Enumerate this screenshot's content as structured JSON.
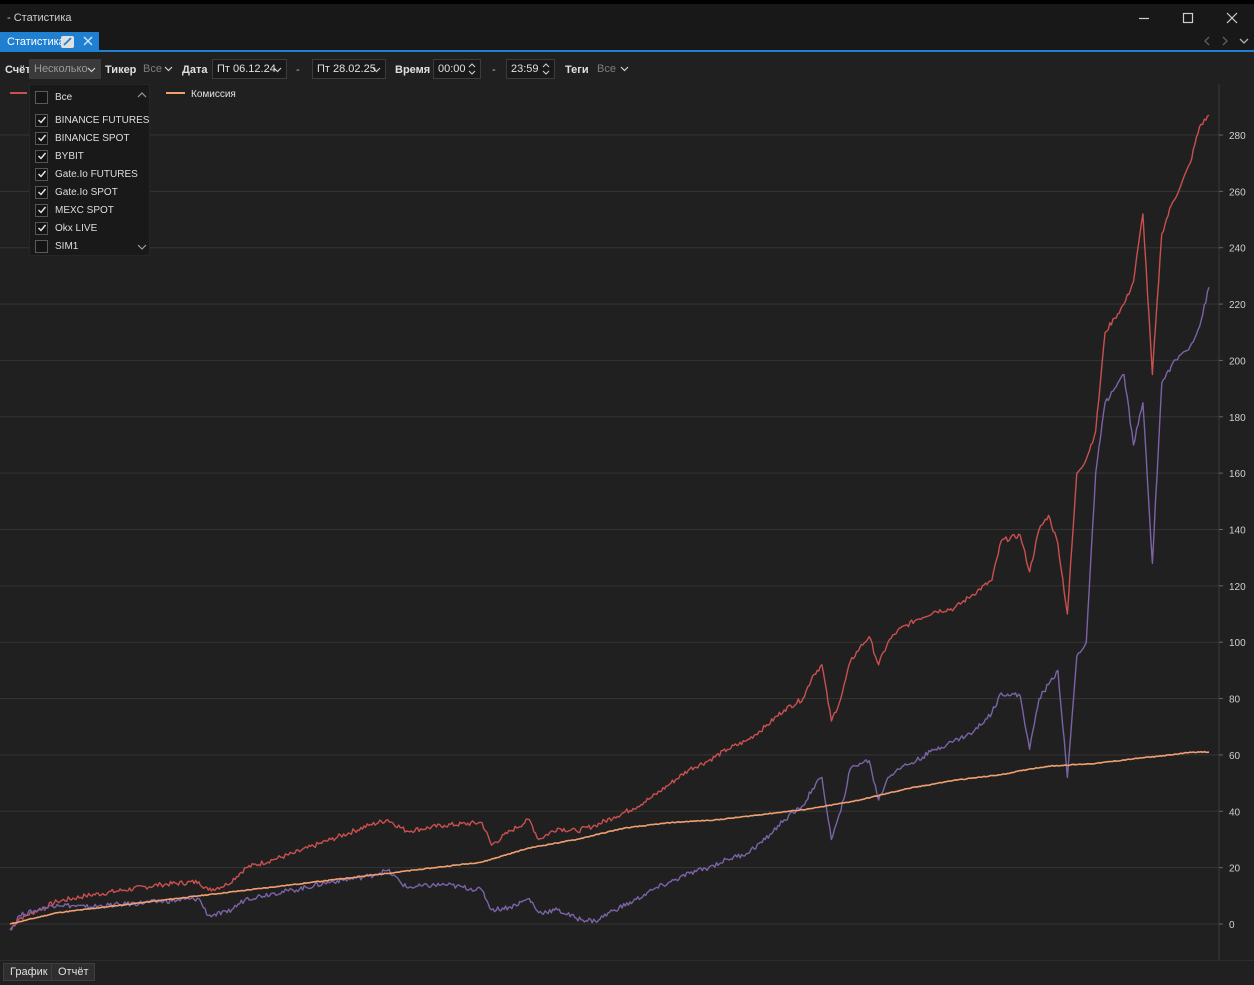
{
  "window": {
    "title": "- Статистика"
  },
  "tab": {
    "label": "Статистика"
  },
  "toolbar": {
    "account_label": "Счёт",
    "account_value": "Несколько",
    "ticker_label": "Тикер",
    "ticker_value": "Все",
    "date_label": "Дата",
    "date_from": "Пт 06.12.24",
    "date_sep": "-",
    "date_to": "Пт 28.02.25",
    "time_label": "Время",
    "time_from": "00:00",
    "time_sep": "-",
    "time_to": "23:59",
    "tags_label": "Теги",
    "tags_value": "Все"
  },
  "account_dropdown": {
    "items": [
      {
        "label": "Все",
        "checked": false
      },
      {
        "label": "BINANCE FUTURES",
        "checked": true
      },
      {
        "label": "BINANCE SPOT",
        "checked": true
      },
      {
        "label": "BYBIT",
        "checked": true
      },
      {
        "label": "Gate.Io FUTURES",
        "checked": true
      },
      {
        "label": "Gate.Io SPOT",
        "checked": true
      },
      {
        "label": "MEXC SPOT",
        "checked": true
      },
      {
        "label": "Okx LIVE",
        "checked": true
      },
      {
        "label": "SIM1",
        "checked": false
      }
    ]
  },
  "chart_data": {
    "type": "line",
    "ylim": [
      -10,
      300
    ],
    "yticks": [
      0,
      20,
      40,
      60,
      80,
      100,
      120,
      140,
      160,
      180,
      200,
      220,
      240,
      260,
      280
    ],
    "grid": true,
    "legend_position": "top-left",
    "series": [
      {
        "name": "",
        "color": "#c9504f",
        "values": [
          [
            0,
            -2
          ],
          [
            1,
            2
          ],
          [
            3,
            5
          ],
          [
            5,
            8
          ],
          [
            8,
            10
          ],
          [
            12,
            12
          ],
          [
            16,
            14
          ],
          [
            20,
            15
          ],
          [
            21,
            12
          ],
          [
            23,
            14
          ],
          [
            25,
            20
          ],
          [
            28,
            23
          ],
          [
            30,
            25
          ],
          [
            34,
            30
          ],
          [
            38,
            35
          ],
          [
            40,
            37
          ],
          [
            42,
            33
          ],
          [
            46,
            35
          ],
          [
            50,
            36
          ],
          [
            51,
            28
          ],
          [
            53,
            33
          ],
          [
            55,
            37
          ],
          [
            56,
            30
          ],
          [
            58,
            34
          ],
          [
            60,
            33
          ],
          [
            62,
            35
          ],
          [
            64,
            38
          ],
          [
            66,
            41
          ],
          [
            68,
            45
          ],
          [
            70,
            50
          ],
          [
            72,
            55
          ],
          [
            74,
            58
          ],
          [
            76,
            62
          ],
          [
            78,
            65
          ],
          [
            80,
            70
          ],
          [
            82,
            76
          ],
          [
            84,
            80
          ],
          [
            85,
            88
          ],
          [
            86,
            92
          ],
          [
            87,
            72
          ],
          [
            88,
            80
          ],
          [
            89,
            93
          ],
          [
            90,
            98
          ],
          [
            91,
            102
          ],
          [
            92,
            92
          ],
          [
            93,
            100
          ],
          [
            94,
            104
          ],
          [
            96,
            108
          ],
          [
            98,
            111
          ],
          [
            100,
            112
          ],
          [
            102,
            117
          ],
          [
            104,
            122
          ],
          [
            105,
            136
          ],
          [
            107,
            138
          ],
          [
            108,
            125
          ],
          [
            109,
            140
          ],
          [
            110,
            145
          ],
          [
            111,
            135
          ],
          [
            112,
            110
          ],
          [
            113,
            160
          ],
          [
            114,
            165
          ],
          [
            115,
            175
          ],
          [
            116,
            210
          ],
          [
            117,
            215
          ],
          [
            118,
            220
          ],
          [
            119,
            228
          ],
          [
            120,
            252
          ],
          [
            121,
            195
          ],
          [
            122,
            245
          ],
          [
            123,
            255
          ],
          [
            124,
            262
          ],
          [
            125,
            270
          ],
          [
            126,
            283
          ],
          [
            127,
            287
          ]
        ]
      },
      {
        "name": "",
        "color": "#7b63a7",
        "values": [
          [
            0,
            -2
          ],
          [
            1,
            3
          ],
          [
            3,
            5
          ],
          [
            5,
            7
          ],
          [
            8,
            6
          ],
          [
            12,
            7
          ],
          [
            16,
            8
          ],
          [
            20,
            9
          ],
          [
            21,
            3
          ],
          [
            23,
            4
          ],
          [
            25,
            9
          ],
          [
            28,
            11
          ],
          [
            30,
            12
          ],
          [
            34,
            15
          ],
          [
            38,
            17
          ],
          [
            40,
            19
          ],
          [
            42,
            13
          ],
          [
            46,
            14
          ],
          [
            50,
            12
          ],
          [
            51,
            5
          ],
          [
            53,
            6
          ],
          [
            55,
            9
          ],
          [
            56,
            4
          ],
          [
            58,
            5
          ],
          [
            60,
            2
          ],
          [
            62,
            1
          ],
          [
            64,
            5
          ],
          [
            66,
            8
          ],
          [
            68,
            12
          ],
          [
            70,
            15
          ],
          [
            72,
            18
          ],
          [
            74,
            20
          ],
          [
            76,
            23
          ],
          [
            78,
            25
          ],
          [
            80,
            30
          ],
          [
            82,
            37
          ],
          [
            84,
            42
          ],
          [
            85,
            48
          ],
          [
            86,
            52
          ],
          [
            87,
            30
          ],
          [
            88,
            40
          ],
          [
            89,
            55
          ],
          [
            90,
            57
          ],
          [
            91,
            58
          ],
          [
            92,
            44
          ],
          [
            93,
            52
          ],
          [
            94,
            55
          ],
          [
            96,
            58
          ],
          [
            98,
            62
          ],
          [
            100,
            65
          ],
          [
            102,
            68
          ],
          [
            104,
            75
          ],
          [
            105,
            82
          ],
          [
            107,
            81
          ],
          [
            108,
            62
          ],
          [
            109,
            80
          ],
          [
            110,
            85
          ],
          [
            111,
            90
          ],
          [
            112,
            52
          ],
          [
            113,
            95
          ],
          [
            114,
            100
          ],
          [
            115,
            160
          ],
          [
            116,
            185
          ],
          [
            117,
            190
          ],
          [
            118,
            195
          ],
          [
            119,
            170
          ],
          [
            120,
            185
          ],
          [
            121,
            128
          ],
          [
            122,
            192
          ],
          [
            123,
            198
          ],
          [
            124,
            202
          ],
          [
            125,
            205
          ],
          [
            126,
            212
          ],
          [
            127,
            226
          ]
        ]
      },
      {
        "name": "Комиссия",
        "color": "#f0a070",
        "values": [
          [
            0,
            0
          ],
          [
            5,
            4
          ],
          [
            10,
            6
          ],
          [
            15,
            8
          ],
          [
            20,
            10
          ],
          [
            25,
            12
          ],
          [
            30,
            14
          ],
          [
            35,
            16
          ],
          [
            40,
            18
          ],
          [
            45,
            20
          ],
          [
            50,
            22
          ],
          [
            55,
            27
          ],
          [
            60,
            30
          ],
          [
            65,
            34
          ],
          [
            70,
            36
          ],
          [
            75,
            37
          ],
          [
            80,
            39
          ],
          [
            85,
            41
          ],
          [
            90,
            44
          ],
          [
            95,
            48
          ],
          [
            100,
            51
          ],
          [
            105,
            53
          ],
          [
            108,
            55
          ],
          [
            110,
            56
          ],
          [
            115,
            57
          ],
          [
            120,
            59
          ],
          [
            123,
            60
          ],
          [
            125,
            61
          ],
          [
            127,
            61
          ]
        ]
      }
    ]
  },
  "bottom_tabs": {
    "chart_label": "График",
    "report_label": "Отчёт"
  }
}
